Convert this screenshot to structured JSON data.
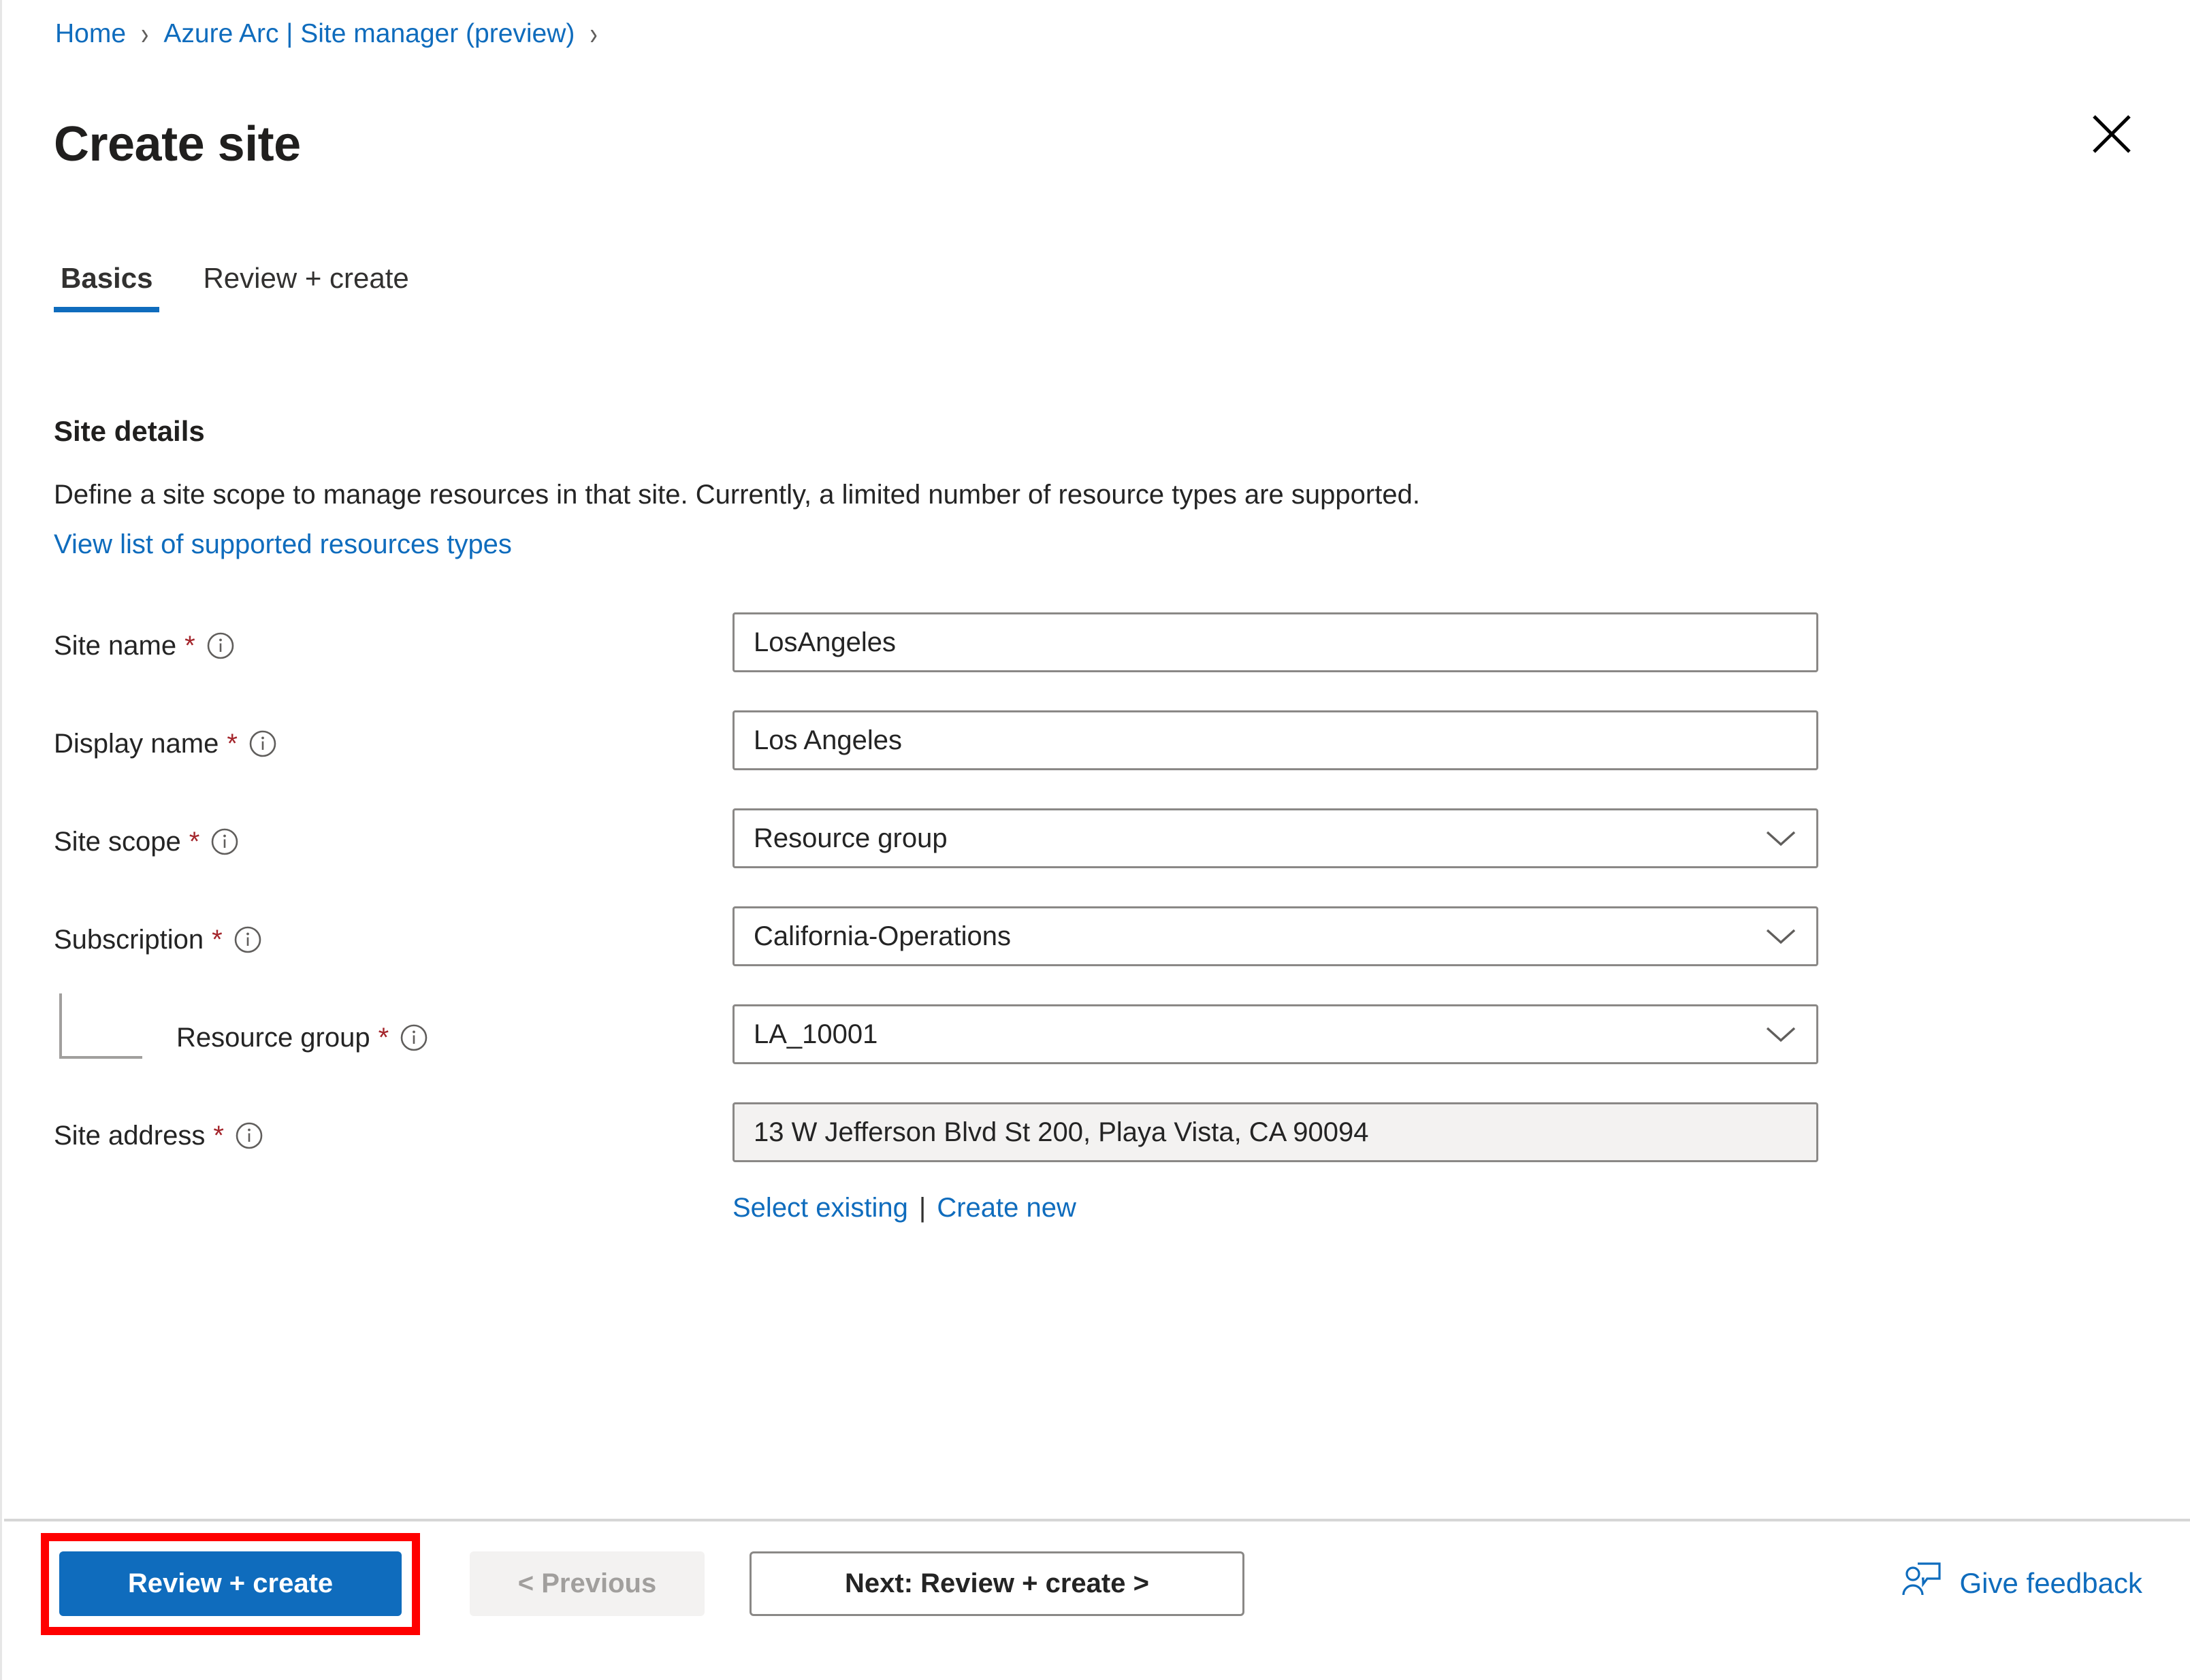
{
  "breadcrumb": {
    "items": [
      {
        "label": "Home",
        "icon": ""
      },
      {
        "label": "Azure Arc | Site manager (preview)",
        "icon": ""
      }
    ],
    "separator": "›"
  },
  "header": {
    "title": "Create site",
    "close_icon": "close-icon"
  },
  "tabs": [
    {
      "label": "Basics",
      "active": true
    },
    {
      "label": "Review + create",
      "active": false
    }
  ],
  "section": {
    "title": "Site details",
    "description": "Define a site scope to manage resources in that site. Currently, a limited number of resource types are supported.",
    "supported_link": "View list of supported resources types"
  },
  "form": {
    "fields": [
      {
        "label": "Site name",
        "required_marker": "*",
        "info_icon": "info-icon",
        "type": "text",
        "value": "LosAngeles",
        "placeholder": "",
        "readonly": false,
        "indented": false
      },
      {
        "label": "Display name",
        "required_marker": "*",
        "info_icon": "info-icon",
        "type": "text",
        "value": "Los Angeles",
        "placeholder": "",
        "readonly": false,
        "indented": false
      },
      {
        "label": "Site scope",
        "required_marker": "*",
        "info_icon": "info-icon",
        "type": "select",
        "value": "Resource group",
        "placeholder": "",
        "readonly": false,
        "indented": false
      },
      {
        "label": "Subscription",
        "required_marker": "*",
        "info_icon": "info-icon",
        "type": "select",
        "value": "California-Operations",
        "placeholder": "",
        "readonly": false,
        "indented": false
      },
      {
        "label": "Resource group",
        "required_marker": "*",
        "info_icon": "info-icon",
        "type": "select",
        "value": "LA_10001",
        "placeholder": "",
        "readonly": false,
        "indented": true
      },
      {
        "label": "Site address",
        "required_marker": "*",
        "info_icon": "info-icon",
        "type": "text",
        "value": "13 W Jefferson Blvd St 200, Playa Vista, CA 90094",
        "placeholder": "",
        "readonly": true,
        "indented": false
      }
    ],
    "address_links": {
      "select_existing": "Select existing",
      "separator": "|",
      "create_new": "Create new"
    }
  },
  "footer": {
    "review_create": "Review + create",
    "previous": "< Previous",
    "next": "Next: Review + create >",
    "give_feedback": "Give feedback",
    "feedback_icon": "person-feedback-icon"
  },
  "annotation": {
    "highlight_target": "Review + create",
    "highlight_color": "#ff0000"
  },
  "colors": {
    "accent": "#0f6cbd",
    "required": "#a4262c",
    "border": "#8a8886",
    "readonly_bg": "#f3f2f1",
    "divider": "#d6d6d6"
  }
}
